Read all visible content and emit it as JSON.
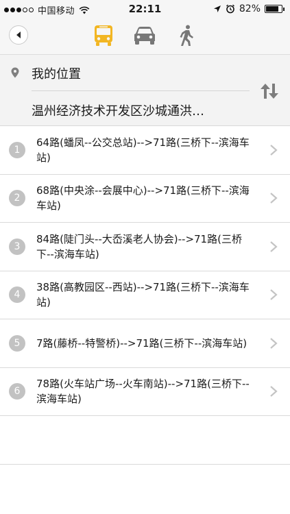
{
  "status_bar": {
    "carrier": "中国移动",
    "time": "22:11",
    "battery": "82%",
    "battery_level": 0.82
  },
  "nav": {
    "back_icon": "chevron-left-icon",
    "modes": [
      {
        "name": "bus",
        "icon": "bus-icon",
        "active": true
      },
      {
        "name": "car",
        "icon": "car-icon",
        "active": false
      },
      {
        "name": "walk",
        "icon": "walk-icon",
        "active": false
      }
    ]
  },
  "route": {
    "from": "我的位置",
    "to": "温州经济技术开发区沙城通洪…"
  },
  "results": [
    {
      "index": "1",
      "text": "64路(蟠凤--公交总站)-->71路(三桥下--滨海车站)"
    },
    {
      "index": "2",
      "text": "68路(中央涂--会展中心)-->71路(三桥下--滨海车站)"
    },
    {
      "index": "3",
      "text": "84路(陡门头--大岙溪老人协会)-->71路(三桥下--滨海车站)"
    },
    {
      "index": "4",
      "text": "38路(高教园区--西站)-->71路(三桥下--滨海车站)"
    },
    {
      "index": "5",
      "text": "7路(藤桥--特警桥)-->71路(三桥下--滨海车站)"
    },
    {
      "index": "6",
      "text": "78路(火车站广场--火车南站)-->71路(三桥下--滨海车站)"
    }
  ],
  "colors": {
    "accent": "#f2b623",
    "inactive_icon": "#777777",
    "badge": "#c2c2c2"
  }
}
